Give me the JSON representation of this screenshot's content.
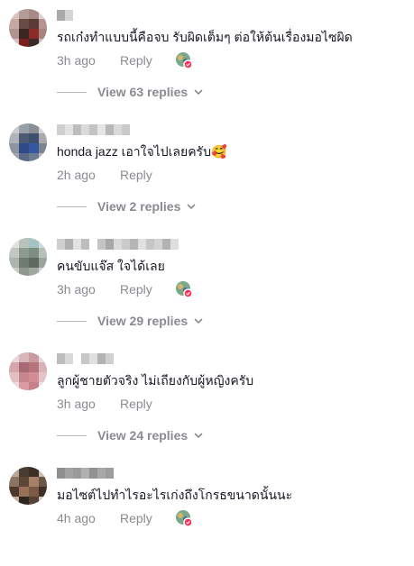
{
  "reply_label": "Reply",
  "comments": [
    {
      "text": "รถเก๋งทำแบบนี้คือจบ รับผิดเต็มๆ ต่อให้ต้นเรื่องมอไซผิด",
      "time": "3h ago",
      "liked_by_creator": true,
      "view_replies": "View 63 replies"
    },
    {
      "text": "honda jazz เอาใจไปเลยครับ🥰",
      "time": "2h ago",
      "liked_by_creator": false,
      "view_replies": "View 2 replies"
    },
    {
      "text": "คนขับแจ๊ส ใจได้เลย",
      "time": "3h ago",
      "liked_by_creator": true,
      "view_replies": "View 29 replies"
    },
    {
      "text": "ลูกผู้ชายตัวจริง ไม่เถียงกับผู้หญิงครับ",
      "time": "3h ago",
      "liked_by_creator": false,
      "view_replies": "View 24 replies"
    },
    {
      "text": "มอไซต์ไปทำไรอะไรเก่งถึงโกรธขนาดนั้นนะ",
      "time": "4h ago",
      "liked_by_creator": true,
      "view_replies": ""
    }
  ],
  "colors": {
    "text": "#161823",
    "secondary": "#8a8b91",
    "divider": "#b9b9bd",
    "badge": "#fe2c55"
  },
  "icons": {
    "chevron": "chevron-down-icon",
    "reaction": "creator-reaction-icon"
  }
}
